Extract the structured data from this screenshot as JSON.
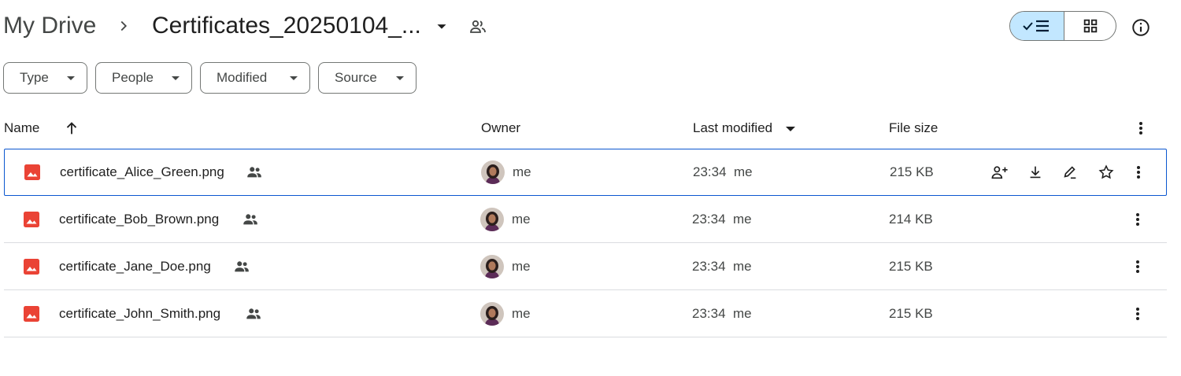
{
  "breadcrumb": {
    "root": "My Drive",
    "current": "Certificates_20250104_..."
  },
  "filters": [
    {
      "label": "Type"
    },
    {
      "label": "People"
    },
    {
      "label": "Modified"
    },
    {
      "label": "Source"
    }
  ],
  "table": {
    "columns": {
      "name": "Name",
      "owner": "Owner",
      "modified": "Last modified",
      "size": "File size"
    },
    "rows": [
      {
        "name": "certificate_Alice_Green.png",
        "owner": "me",
        "modified_time": "23:34",
        "modified_by": "me",
        "size": "215 KB"
      },
      {
        "name": "certificate_Bob_Brown.png",
        "owner": "me",
        "modified_time": "23:34",
        "modified_by": "me",
        "size": "214 KB"
      },
      {
        "name": "certificate_Jane_Doe.png",
        "owner": "me",
        "modified_time": "23:34",
        "modified_by": "me",
        "size": "215 KB"
      },
      {
        "name": "certificate_John_Smith.png",
        "owner": "me",
        "modified_time": "23:34",
        "modified_by": "me",
        "size": "215 KB"
      }
    ]
  },
  "colors": {
    "accent": "#0b57d0",
    "toggle_active": "#c2e7ff",
    "image_icon": "#ea4335"
  },
  "icons": {
    "view_list": "checkmark-list-icon",
    "view_grid": "grid-icon",
    "info": "info-icon",
    "file": "image-file-icon",
    "shared": "shared-people-icon"
  }
}
